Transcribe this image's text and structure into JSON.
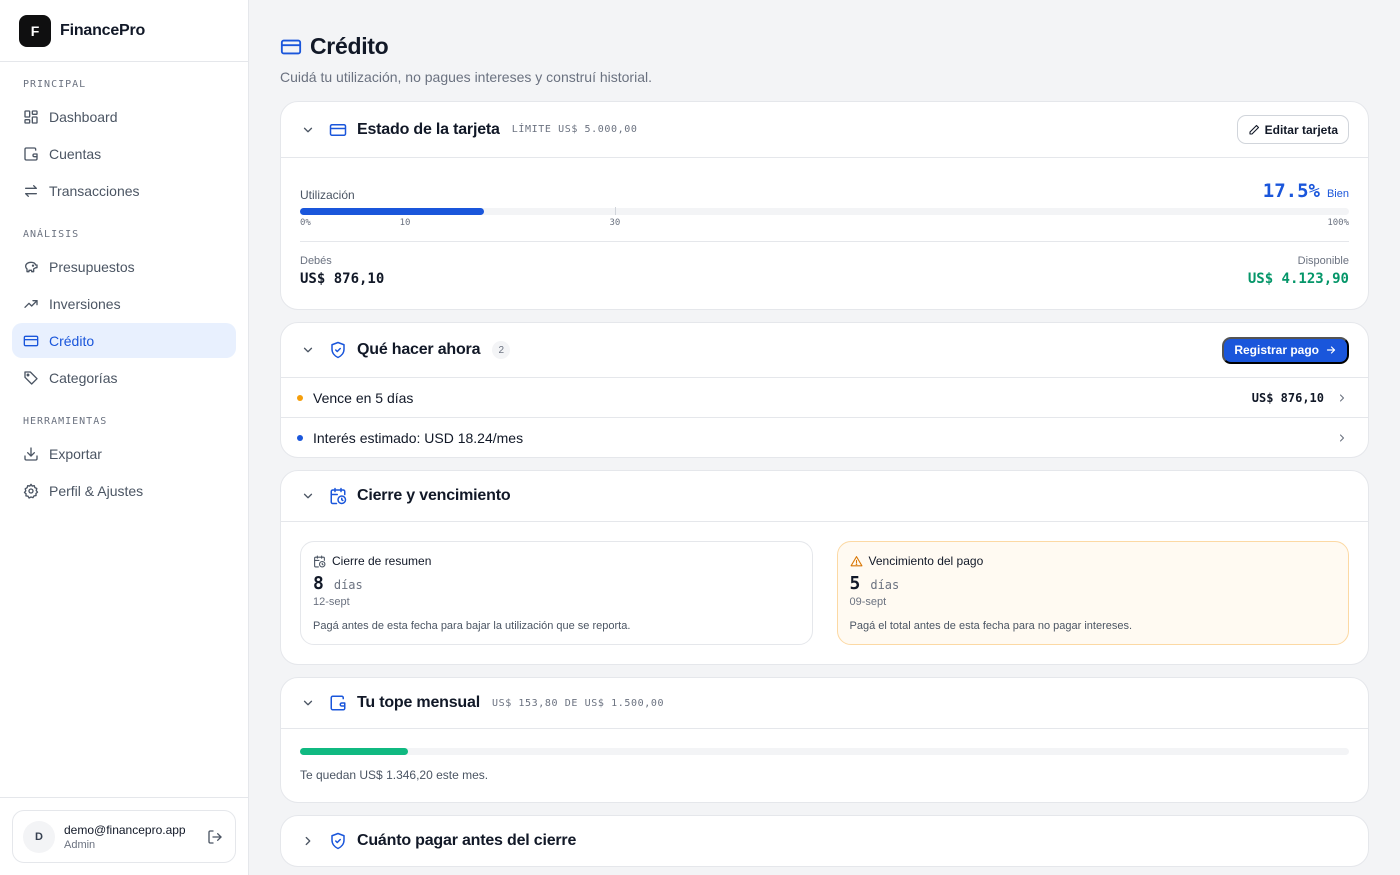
{
  "brand": {
    "logo_letter": "F",
    "name": "FinancePro"
  },
  "sidebar": {
    "sections": [
      {
        "label": "PRINCIPAL"
      },
      {
        "label": "ANÁLISIS"
      },
      {
        "label": "HERRAMIENTAS"
      }
    ],
    "items": [
      {
        "label": "Dashboard",
        "icon": "dashboard-icon"
      },
      {
        "label": "Cuentas",
        "icon": "wallet-icon"
      },
      {
        "label": "Transacciones",
        "icon": "transfer-icon"
      },
      {
        "label": "Presupuestos",
        "icon": "piggy-bank-icon"
      },
      {
        "label": "Inversiones",
        "icon": "trending-up-icon"
      },
      {
        "label": "Crédito",
        "icon": "credit-card-icon",
        "active": true
      },
      {
        "label": "Categorías",
        "icon": "tag-icon"
      },
      {
        "label": "Exportar",
        "icon": "download-icon"
      },
      {
        "label": "Perfil & Ajustes",
        "icon": "gear-icon"
      }
    ]
  },
  "user": {
    "initial": "D",
    "email": "demo@financepro.app",
    "role": "Admin"
  },
  "page": {
    "title": "Crédito",
    "subtitle": "Cuidá tu utilización, no pagues intereses y construí historial."
  },
  "card_status": {
    "title": "Estado de la tarjeta",
    "limit": "LÍMITE US$ 5.000,00",
    "edit_label": "Editar tarjeta",
    "utilization_label": "Utilización",
    "utilization_value": "17.5%",
    "utilization_fraction": 0.175,
    "utilization_status": "Bien",
    "scale_labels": [
      "0%",
      "10",
      "30",
      "100%"
    ],
    "owed_label": "Debés",
    "owed_value": "US$ 876,10",
    "available_label": "Disponible",
    "available_value": "US$ 4.123,90"
  },
  "card_actions": {
    "title": "Qué hacer ahora",
    "count": "2",
    "register_label": "Registrar pago",
    "items": [
      {
        "text": "Vence en 5 días",
        "amount": "US$ 876,10",
        "dot_color": "#f59e0b"
      },
      {
        "text": "Interés estimado: USD 18.24/mes",
        "amount": "",
        "dot_color": "#1a56db"
      }
    ]
  },
  "card_dates": {
    "title": "Cierre y vencimiento",
    "closing": {
      "label": "Cierre de resumen",
      "days": "8",
      "unit": "días",
      "date": "12-sept",
      "note": "Pagá antes de esta fecha para bajar la utilización que se reporta."
    },
    "due": {
      "label": "Vencimiento del pago",
      "days": "5",
      "unit": "días",
      "date": "09-sept",
      "note": "Pagá el total antes de esta fecha para no pagar intereses."
    }
  },
  "card_cap": {
    "title": "Tu tope mensual",
    "meta": "US$ 153,80 DE US$ 1.500,00",
    "fraction": 0.1025,
    "note": "Te quedan US$ 1.346,20 este mes."
  },
  "card_pay": {
    "title": "Cuánto pagar antes del cierre"
  },
  "colors": {
    "accent": "#1a56db",
    "success": "#059669",
    "bar_green": "#10b981",
    "warning": "#f59e0b"
  }
}
